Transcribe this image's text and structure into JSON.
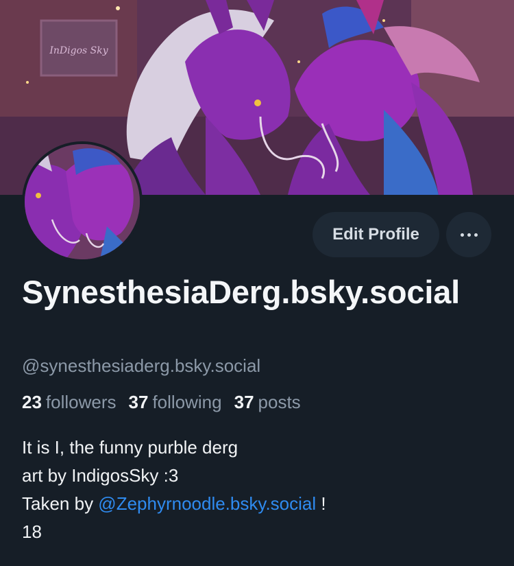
{
  "banner": {
    "artist_sign": "InDigos Sky"
  },
  "actions": {
    "edit_profile_label": "Edit Profile"
  },
  "profile": {
    "display_name": "SynesthesiaDerg.bsky.social",
    "handle": "@synesthesiaderg.bsky.social"
  },
  "stats": {
    "followers_count": "23",
    "followers_label": "followers",
    "following_count": "37",
    "following_label": "following",
    "posts_count": "37",
    "posts_label": "posts"
  },
  "bio": {
    "line1": "It is I, the funny purble derg",
    "line2": "art by IndigosSky :3",
    "line3_prefix": "Taken by ",
    "line3_mention": "@Zephyrnoodle.bsky.social",
    "line3_suffix": " !",
    "line4": "18"
  },
  "colors": {
    "background": "#161e27",
    "button_bg": "#1e2935",
    "muted_text": "#8c99a8",
    "link": "#2f8bf0"
  }
}
